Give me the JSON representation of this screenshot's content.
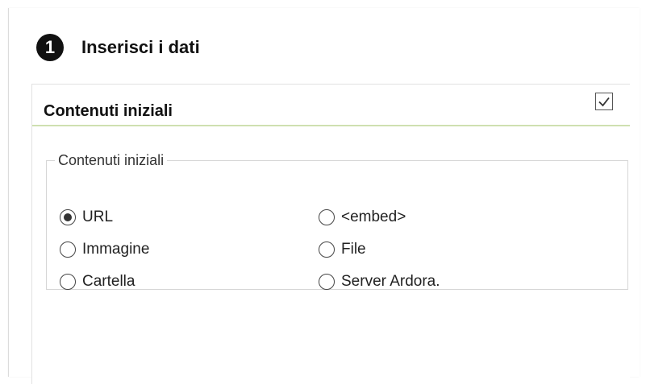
{
  "header": {
    "step_number": "1",
    "title": "Inserisci i dati"
  },
  "section": {
    "title": "Contenuti iniziali",
    "checkbox_checked": true
  },
  "group": {
    "legend": "Contenuti iniziali",
    "options": [
      {
        "label": "URL",
        "selected": true
      },
      {
        "label": "Immagine",
        "selected": false
      },
      {
        "label": "Cartella",
        "selected": false
      },
      {
        "label": "<embed>",
        "selected": false
      },
      {
        "label": "File",
        "selected": false
      },
      {
        "label": "Server Ardora.",
        "selected": false
      }
    ]
  }
}
